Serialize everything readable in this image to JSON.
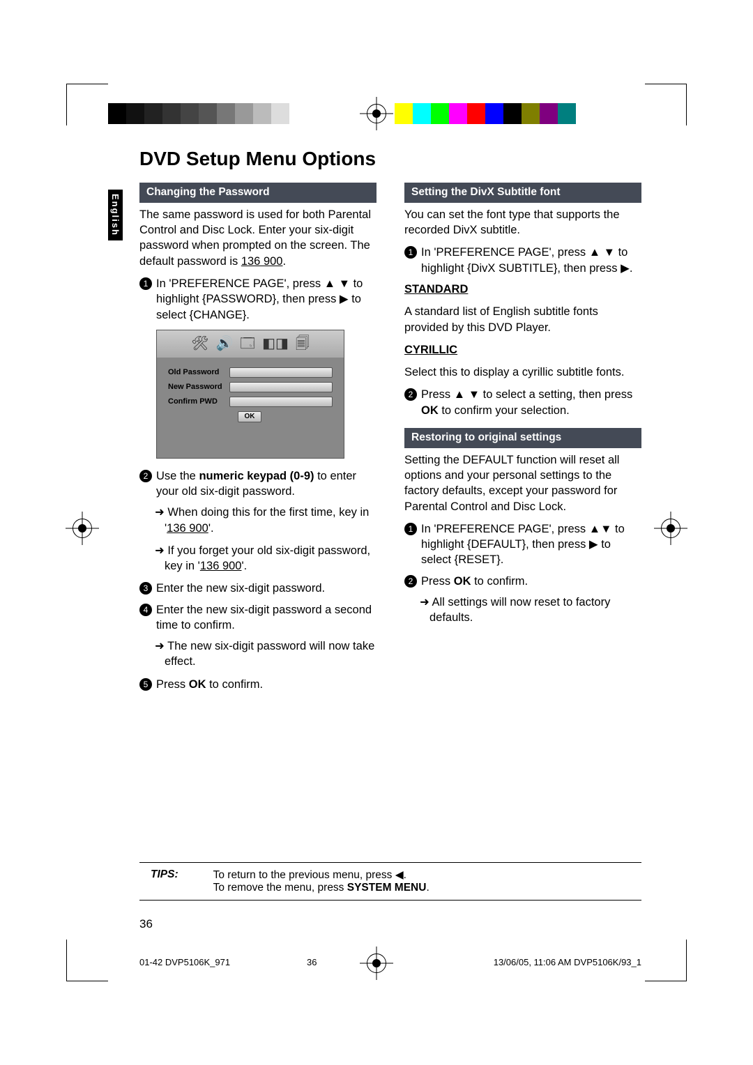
{
  "side_tab": "English",
  "title": "DVD Setup Menu Options",
  "left": {
    "head": "Changing the Password",
    "intro1": "The same password is used for both Parental Control and Disc Lock.  Enter your six-digit password when prompted on the screen.  The default password is ",
    "intro_pw": "136 900",
    "s1a": "In 'PREFERENCE PAGE', press ",
    "s1b": " to highlight {PASSWORD}, then press ",
    "s1c": " to select {CHANGE}.",
    "ui": {
      "old": "Old Password",
      "new": "New Password",
      "conf": "Confirm PWD",
      "ok": "OK"
    },
    "s2a": "Use the ",
    "s2b": "numeric keypad (0-9)",
    "s2c": " to enter your old six-digit password.",
    "s2sub1a": "When doing this for the first time, key in '",
    "s2sub1b": "136 900",
    "s2sub1c": "'.",
    "s2sub2a": "If you forget your old six-digit password, key in '",
    "s2sub2b": "136 900",
    "s2sub2c": "'.",
    "s3": "Enter the new six-digit password.",
    "s4": "Enter the new six-digit password a second time to confirm.",
    "s4sub": "The new six-digit password will now take effect.",
    "s5a": "Press ",
    "s5b": "OK",
    "s5c": " to confirm."
  },
  "right": {
    "head1": "Setting the DivX Subtitle font",
    "p1": "You can set the font type that supports the recorded DivX subtitle.",
    "r1a": "In 'PREFERENCE PAGE', press ",
    "r1b": " to highlight {DivX SUBTITLE}, then press ",
    "r1c": ".",
    "std_h": "STANDARD",
    "std_p": "A standard list of English subtitle fonts provided by this DVD Player.",
    "cyr_h": "CYRILLIC",
    "cyr_p": "Select this to display a cyrillic subtitle fonts.",
    "r2a": "Press ",
    "r2b": " to select a setting, then press ",
    "r2c": "OK",
    "r2d": " to confirm your selection.",
    "head2": "Restoring to original settings",
    "rp1": "Setting the DEFAULT function will reset all options and your personal settings to the factory defaults, except your password for Parental Control and Disc Lock.",
    "rr1a": "In 'PREFERENCE PAGE', press ",
    "rr1b": " to highlight {DEFAULT}, then press ",
    "rr1c": "  to select {RESET}.",
    "rr2a": "Press ",
    "rr2b": "OK",
    "rr2c": " to confirm.",
    "rr2sub": "All settings will now reset to factory defaults."
  },
  "tips": {
    "label": "TIPS:",
    "l1a": "To return to the previous menu, press ",
    "l1b": ".",
    "l2a": "To remove the menu, press ",
    "l2b": "SYSTEM MENU",
    "l2c": "."
  },
  "page_num": "36",
  "footer": {
    "left": "01-42 DVP5106K_971",
    "mid": "36",
    "right_a": "13/06/05, 11:06 AM",
    "right_b": "DVP5106K/93_1"
  },
  "gray_bars": [
    "#000",
    "#111",
    "#222",
    "#333",
    "#444",
    "#555",
    "#777",
    "#999",
    "#bbb",
    "#ddd",
    "#fff"
  ],
  "color_bars": [
    "#fff",
    "#ff0",
    "#0ff",
    "#0f0",
    "#f0f",
    "#f00",
    "#00f",
    "#000",
    "#7f7f00",
    "#7f007f",
    "#007f7f"
  ]
}
